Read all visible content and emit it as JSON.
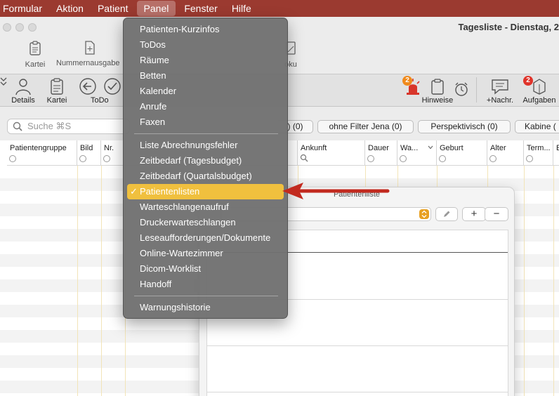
{
  "menubar": {
    "items": [
      "Formular",
      "Aktion",
      "Patient",
      "Panel",
      "Fenster",
      "Hilfe"
    ]
  },
  "window": {
    "title": "Tagesliste - Dienstag, 2"
  },
  "toolbar1": {
    "kartei": "Kartei",
    "nummernausgabe": "Nummernausgabe",
    "doku": "oku"
  },
  "toolbar2": {
    "details": "Details",
    "kartei": "Kartei",
    "todo": "ToDo",
    "hinweise": "Hinweise",
    "hinweise_badge": "2",
    "nachr": "+Nachr.",
    "aufgaben": "Aufgaben",
    "aufgaben_badge": "2"
  },
  "filterbar": {
    "search_placeholder": "Suche ⌘S",
    "chips": [
      ") (0)",
      "ohne Filter Jena (0)",
      "Perspektivisch (0)",
      "Kabine ("
    ]
  },
  "table": {
    "columns": [
      "Patientengruppe",
      "Bild",
      "Nr.",
      "Ankunft",
      "Dauer",
      "Wa...",
      "Geburt",
      "Alter",
      "Term...",
      "E"
    ]
  },
  "patient_list_panel": {
    "title": "Patientenliste",
    "add_label": "+",
    "remove_label": "−"
  },
  "panel_menu": {
    "group1": [
      "Patienten-Kurzinfos",
      "ToDos",
      "Räume",
      "Betten",
      "Kalender",
      "Anrufe",
      "Faxen"
    ],
    "group2": [
      "Liste Abrechnungsfehler",
      "Zeitbedarf (Tagesbudget)",
      "Zeitbedarf (Quartalsbudget)",
      "Patientenlisten",
      "Warteschlangenaufruf",
      "Druckerwarteschlangen",
      "Leseaufforderungen/Dokumente",
      "Online-Wartezimmer",
      "Dicom-Worklist",
      "Handoff"
    ],
    "group3": [
      "Warnungshistorie"
    ],
    "checkmark": "✓"
  },
  "colors": {
    "menubar": "#9b3a30",
    "menu_highlight": "#f0c03e",
    "badge_red": "#e0342b",
    "badge_orange": "#f08a1c",
    "arrow": "#c22a1f"
  }
}
